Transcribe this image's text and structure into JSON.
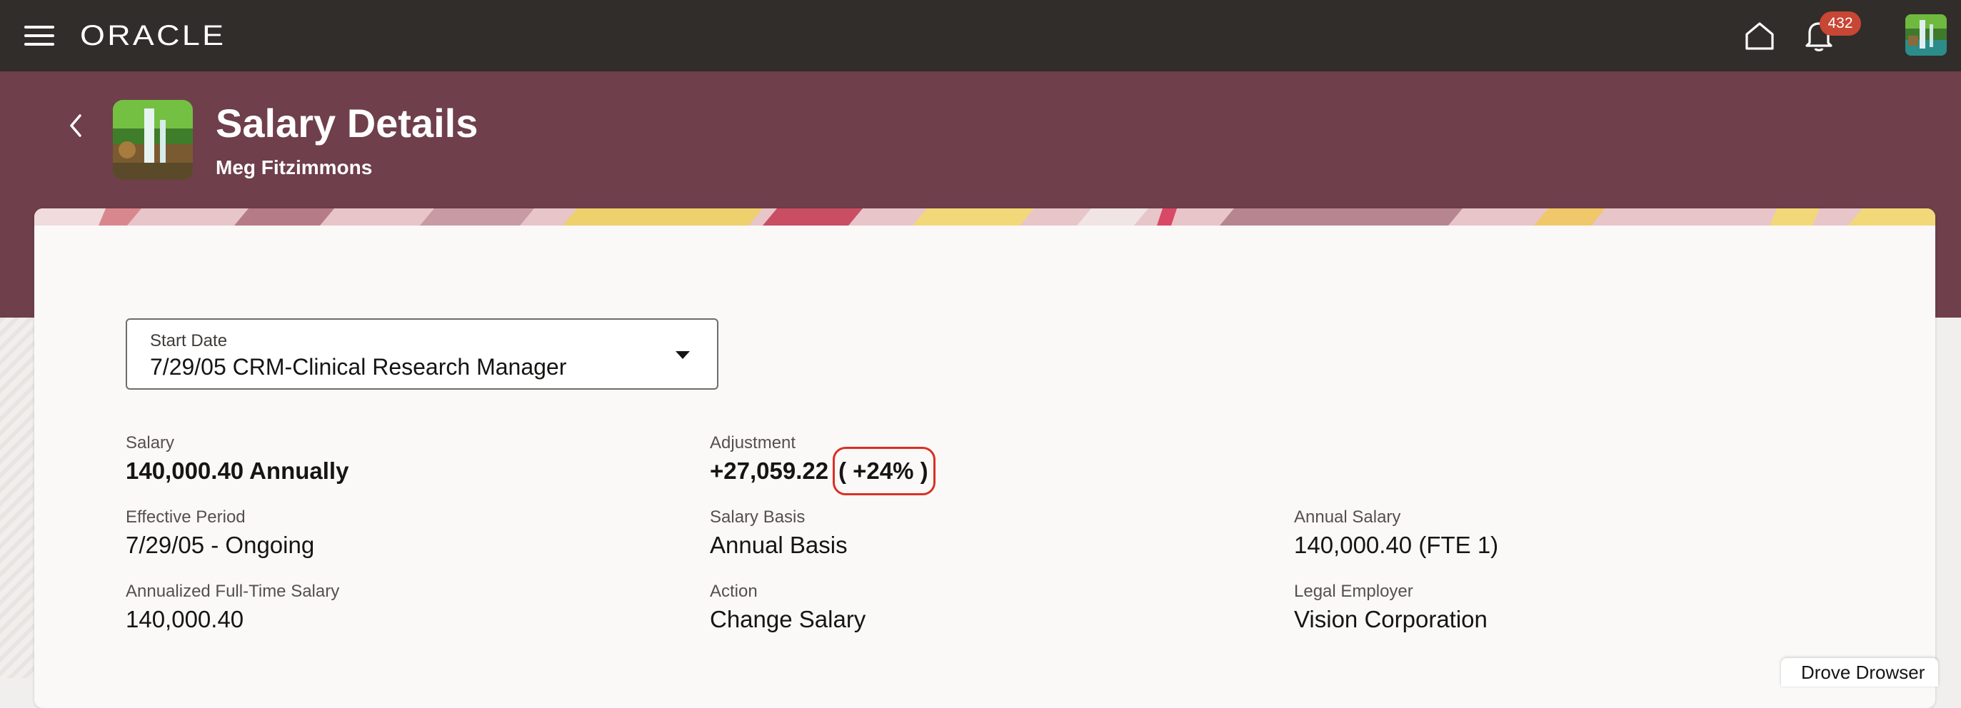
{
  "topbar": {
    "brand": "ORACLE",
    "notification_count": "432",
    "icons": [
      "menu-icon",
      "home-icon",
      "bell-icon",
      "avatar"
    ]
  },
  "header": {
    "title": "Salary Details",
    "subtitle": "Meg Fitzimmons"
  },
  "selector": {
    "label": "Start Date",
    "value": "7/29/05 CRM-Clinical Research Manager"
  },
  "fields": {
    "salary": {
      "label": "Salary",
      "value": "140,000.40 Annually"
    },
    "adjustment": {
      "label": "Adjustment",
      "value": "+27,059.22",
      "percent": "( +24% )"
    },
    "effective_period": {
      "label": "Effective Period",
      "value": "7/29/05 - Ongoing"
    },
    "salary_basis": {
      "label": "Salary Basis",
      "value": "Annual Basis"
    },
    "annual_salary": {
      "label": "Annual Salary",
      "value": "140,000.40 (FTE 1)"
    },
    "annualized_fte": {
      "label": "Annualized Full-Time Salary",
      "value": "140,000.40"
    },
    "action": {
      "label": "Action",
      "value": "Change Salary"
    },
    "legal_employer": {
      "label": "Legal Employer",
      "value": "Vision Corporation"
    }
  },
  "bottom_tab": {
    "label": "Drove Drowser"
  },
  "colors": {
    "topbar": "#312d2a",
    "header_band": "#6f3f4b",
    "badge": "#c74634",
    "highlight": "#d93025"
  }
}
